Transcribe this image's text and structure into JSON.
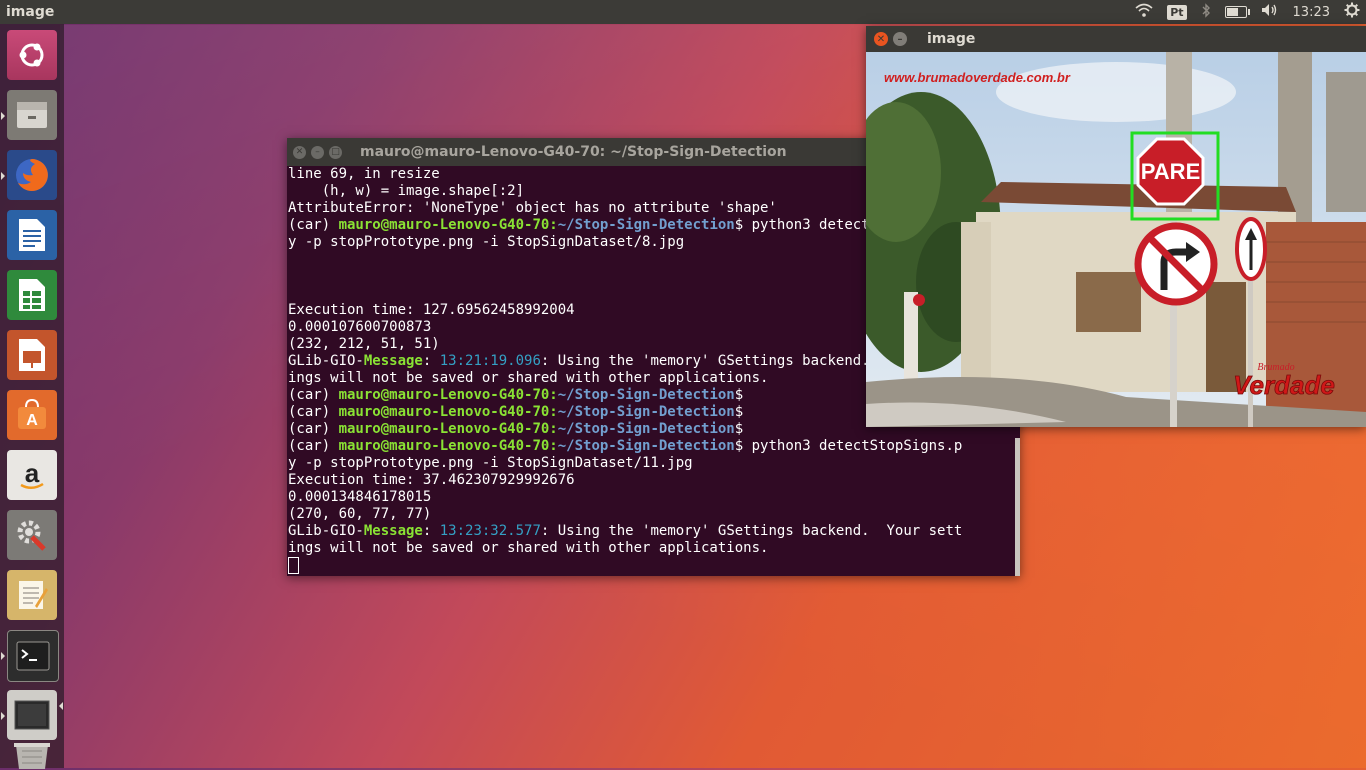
{
  "top_panel": {
    "app_title": "image",
    "keyboard_layout": "Pt",
    "time": "13:23",
    "battery_level": 0.6
  },
  "launcher": {
    "items": [
      {
        "name": "ubuntu-dash-icon"
      },
      {
        "name": "files-icon"
      },
      {
        "name": "firefox-icon"
      },
      {
        "name": "libreoffice-writer-icon"
      },
      {
        "name": "libreoffice-calc-icon"
      },
      {
        "name": "libreoffice-impress-icon"
      },
      {
        "name": "ubuntu-software-icon"
      },
      {
        "name": "amazon-icon"
      },
      {
        "name": "system-settings-icon"
      },
      {
        "name": "text-editor-icon"
      },
      {
        "name": "terminal-icon"
      },
      {
        "name": "image-window-icon"
      },
      {
        "name": "trash-icon"
      }
    ]
  },
  "terminal": {
    "title": "mauro@mauro-Lenovo-G40-70: ~/Stop-Sign-Detection",
    "user_host": "mauro@mauro-Lenovo-G40-70",
    "path": "~/Stop-Sign-Detection",
    "env": "(car) ",
    "lines": {
      "l1": "line 69, in resize",
      "l2": "    (h, w) = image.shape[:2]",
      "l3": "AttributeError: 'NoneType' object has no attribute 'shape'",
      "cmd1_a": " python3 detectStopSigns.p",
      "cmd1_b": "y -p stopPrototype.png -i StopSignDataset/8.jpg",
      "exec1": "Execution time: 127.69562458992004",
      "val1": "0.000107600700873",
      "box1": "(232, 212, 51, 51)",
      "glib_prefix": "GLib-GIO-",
      "glib_message": "Message",
      "glib_ts1": "13:21:19.096",
      "glib_msg_a": ": Using the 'memory' GSettings backend.  Your sett",
      "glib_msg_b": "ings will not be saved or shared with other applications.",
      "cmd2_a": " python3 detectStopSigns.p",
      "cmd2_b": "y -p stopPrototype.png -i StopSignDataset/11.jpg",
      "exec2": "Execution time: 37.462307929992676",
      "val2": "0.000134846178015",
      "box2": "(270, 60, 77, 77)",
      "glib_ts2": "13:23:32.577"
    }
  },
  "image_window": {
    "title": "image",
    "watermark_url": "www.brumadoverdade.com.br",
    "sign_text": "PARE",
    "logo_text": "Verdade",
    "logo_small": "Brumado"
  },
  "colors": {
    "accent": "#e95420",
    "terminal_bg": "#300a24",
    "prompt_green": "#8ae234",
    "prompt_blue": "#729fcf",
    "detection_box": "#22dd22"
  }
}
